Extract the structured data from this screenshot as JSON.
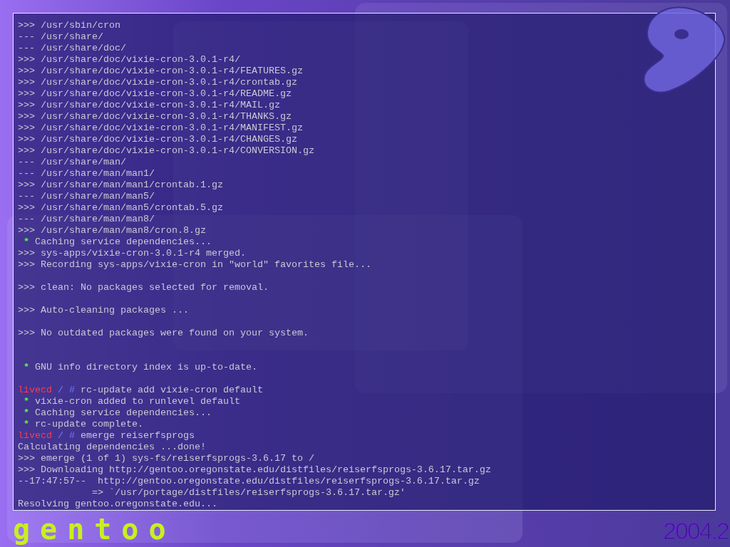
{
  "console": {
    "lines": [
      {
        "kind": "plain",
        "text": ">>> /usr/sbin/cron"
      },
      {
        "kind": "plain",
        "text": "--- /usr/share/"
      },
      {
        "kind": "plain",
        "text": "--- /usr/share/doc/"
      },
      {
        "kind": "plain",
        "text": ">>> /usr/share/doc/vixie-cron-3.0.1-r4/"
      },
      {
        "kind": "plain",
        "text": ">>> /usr/share/doc/vixie-cron-3.0.1-r4/FEATURES.gz"
      },
      {
        "kind": "plain",
        "text": ">>> /usr/share/doc/vixie-cron-3.0.1-r4/crontab.gz"
      },
      {
        "kind": "plain",
        "text": ">>> /usr/share/doc/vixie-cron-3.0.1-r4/README.gz"
      },
      {
        "kind": "plain",
        "text": ">>> /usr/share/doc/vixie-cron-3.0.1-r4/MAIL.gz"
      },
      {
        "kind": "plain",
        "text": ">>> /usr/share/doc/vixie-cron-3.0.1-r4/THANKS.gz"
      },
      {
        "kind": "plain",
        "text": ">>> /usr/share/doc/vixie-cron-3.0.1-r4/MANIFEST.gz"
      },
      {
        "kind": "plain",
        "text": ">>> /usr/share/doc/vixie-cron-3.0.1-r4/CHANGES.gz"
      },
      {
        "kind": "plain",
        "text": ">>> /usr/share/doc/vixie-cron-3.0.1-r4/CONVERSION.gz"
      },
      {
        "kind": "plain",
        "text": "--- /usr/share/man/"
      },
      {
        "kind": "plain",
        "text": "--- /usr/share/man/man1/"
      },
      {
        "kind": "plain",
        "text": ">>> /usr/share/man/man1/crontab.1.gz"
      },
      {
        "kind": "plain",
        "text": "--- /usr/share/man/man5/"
      },
      {
        "kind": "plain",
        "text": ">>> /usr/share/man/man5/crontab.5.gz"
      },
      {
        "kind": "plain",
        "text": "--- /usr/share/man/man8/"
      },
      {
        "kind": "plain",
        "text": ">>> /usr/share/man/man8/cron.8.gz"
      },
      {
        "kind": "bullet",
        "marker": "*",
        "text": "Caching service dependencies..."
      },
      {
        "kind": "plain",
        "text": ">>> sys-apps/vixie-cron-3.0.1-r4 merged."
      },
      {
        "kind": "plain",
        "text": ">>> Recording sys-apps/vixie-cron in \"world\" favorites file..."
      },
      {
        "kind": "blank"
      },
      {
        "kind": "plain",
        "text": ">>> clean: No packages selected for removal."
      },
      {
        "kind": "blank"
      },
      {
        "kind": "plain",
        "text": ">>> Auto-cleaning packages ..."
      },
      {
        "kind": "blank"
      },
      {
        "kind": "plain",
        "text": ">>> No outdated packages were found on your system."
      },
      {
        "kind": "blank"
      },
      {
        "kind": "blank"
      },
      {
        "kind": "bullet",
        "marker": "*",
        "text": "GNU info directory index is up-to-date."
      },
      {
        "kind": "blank"
      },
      {
        "kind": "prompt",
        "host": "livecd",
        "cwd": "/",
        "sign": "#",
        "command": "rc-update add vixie-cron default"
      },
      {
        "kind": "bullet",
        "marker": "*",
        "text": "vixie-cron added to runlevel default"
      },
      {
        "kind": "bullet",
        "marker": "*",
        "text": "Caching service dependencies..."
      },
      {
        "kind": "bullet",
        "marker": "*",
        "text": "rc-update complete."
      },
      {
        "kind": "prompt",
        "host": "livecd",
        "cwd": "/",
        "sign": "#",
        "command": "emerge reiserfsprogs"
      },
      {
        "kind": "plain",
        "text": "Calculating dependencies ...done!"
      },
      {
        "kind": "plain",
        "text": ">>> emerge (1 of 1) sys-fs/reiserfsprogs-3.6.17 to /"
      },
      {
        "kind": "plain",
        "text": ">>> Downloading http://gentoo.oregonstate.edu/distfiles/reiserfsprogs-3.6.17.tar.gz"
      },
      {
        "kind": "plain",
        "text": "--17:47:57--  http://gentoo.oregonstate.edu/distfiles/reiserfsprogs-3.6.17.tar.gz"
      },
      {
        "kind": "continuation",
        "text": "=> `/usr/portage/distfiles/reiserfsprogs-3.6.17.tar.gz'"
      },
      {
        "kind": "plain",
        "text": "Resolving gentoo.oregonstate.edu..."
      }
    ]
  },
  "branding": {
    "wordmark": "gentoo",
    "version": "2004.2"
  }
}
